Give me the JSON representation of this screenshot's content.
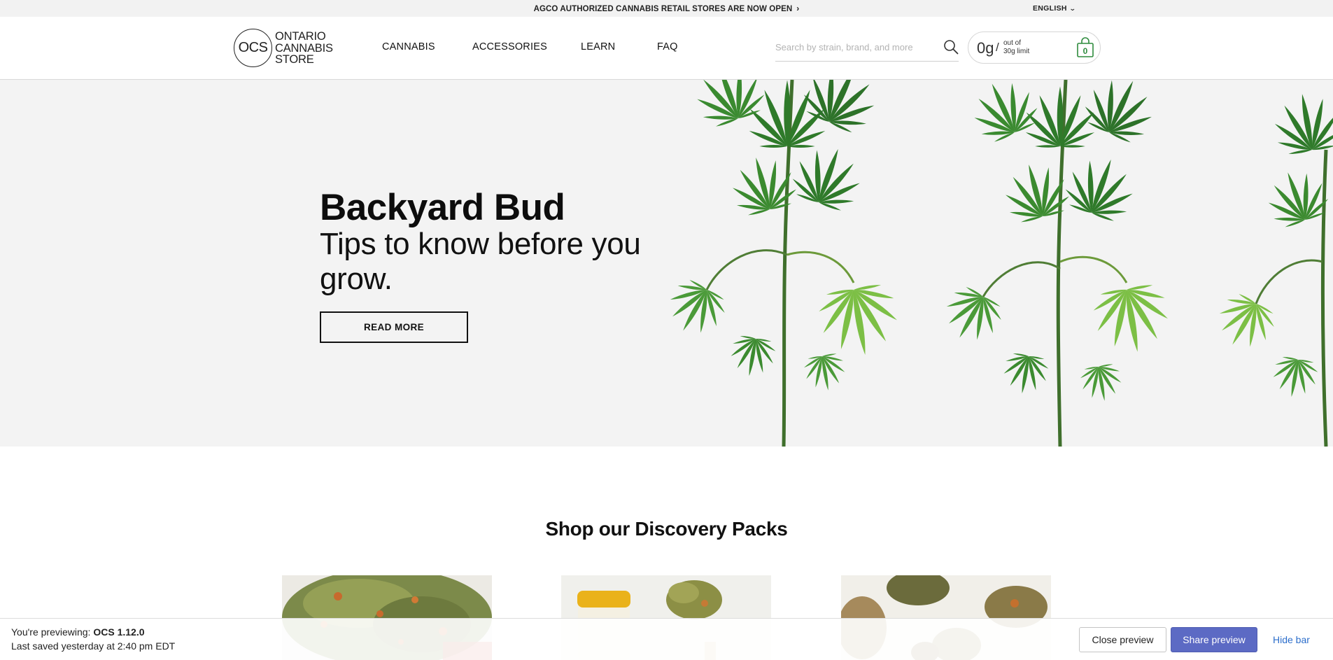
{
  "topbar": {
    "announcement": "AGCO AUTHORIZED CANNABIS RETAIL STORES ARE NOW OPEN",
    "announcement_icon": "chevron-right-icon",
    "language": "ENGLISH",
    "language_icon": "chevron-down-icon"
  },
  "header": {
    "logo": {
      "mark": "OCS",
      "line1": "ONTARIO",
      "line2": "CANNABIS",
      "line3": "STORE"
    },
    "nav": [
      {
        "label": "CANNABIS"
      },
      {
        "label": "ACCESSORIES"
      },
      {
        "label": "LEARN"
      },
      {
        "label": "FAQ"
      }
    ],
    "search": {
      "placeholder": "Search by strain, brand, and more",
      "icon": "search-icon"
    },
    "cart": {
      "grams": "0g",
      "separator": "/",
      "limit_line1": "out of",
      "limit_line2": "30g limit",
      "count": "0",
      "icon": "shopping-bag-icon",
      "accent_color": "#2e8b3d"
    }
  },
  "hero": {
    "title": "Backyard Bud",
    "subtitle": "Tips to know before you grow.",
    "button": "READ MORE"
  },
  "discovery": {
    "title": "Shop our Discovery Packs"
  },
  "preview_bar": {
    "previewing_prefix": "You're previewing:",
    "version": "OCS 1.12.0",
    "saved": "Last saved yesterday at 2:40 pm EDT",
    "close_label": "Close preview",
    "share_label": "Share preview",
    "hide_label": "Hide bar",
    "share_color": "#5c6ac4",
    "link_color": "#2c6ecb"
  }
}
